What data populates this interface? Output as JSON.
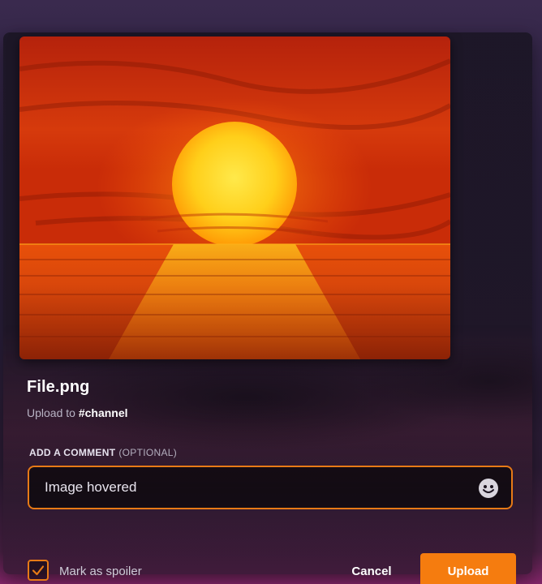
{
  "file": {
    "name": "File.png",
    "upload_to_prefix": "Upload to ",
    "channel": "#channel"
  },
  "comment": {
    "label": "ADD A COMMENT",
    "optional": "(OPTIONAL)",
    "value": "Image hovered"
  },
  "spoiler": {
    "label": "Mark as spoiler",
    "checked": true
  },
  "actions": {
    "cancel": "Cancel",
    "upload": "Upload"
  },
  "icons": {
    "emoji": "emoji-smiley-icon",
    "check": "checkmark-icon"
  },
  "colors": {
    "accent": "#f57c0f",
    "focus_border": "#e77a16"
  }
}
